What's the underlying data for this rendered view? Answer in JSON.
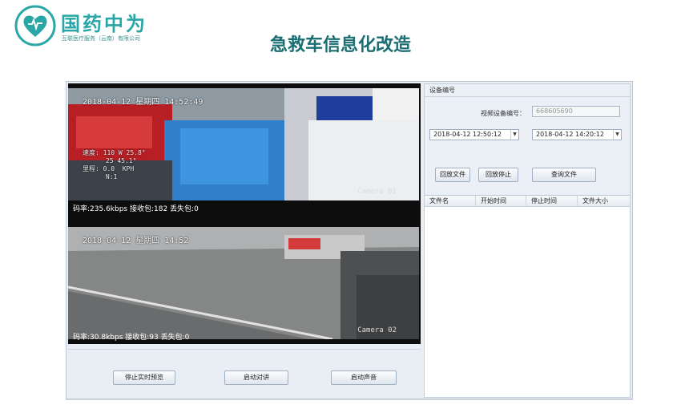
{
  "branding": {
    "company_name": "国药中为",
    "company_sub": "互联医疗服务（云南）有限公司",
    "brand_color": "#2aa6a6"
  },
  "slide": {
    "title": "急救车信息化改造",
    "title_color": "#1c6e73"
  },
  "video": {
    "camera1": {
      "timestamp": "2018-04-12 星期四 14:52:49",
      "label": "Camera 01",
      "speed_overlay": "速度: 110 W 25.8°\n      25 45.1°\n里程: 0.0  KPH\n      N:1",
      "stats": "码率:235.6kbps  接收包:182  丢失包:0"
    },
    "camera2": {
      "timestamp": "2018-04-12 星期四 14:52",
      "label": "Camera 02",
      "stats": "码率:30.8kbps  接收包:93  丢失包:0"
    }
  },
  "controls": {
    "stop_preview": "停止实时预览",
    "start_talk": "启动对讲",
    "start_sound": "启动声音"
  },
  "right_panel": {
    "header": "设备编号",
    "device_label": "视频设备编号：",
    "device_value": "668605690",
    "start_time": "2018-04-12 12:50:12",
    "end_time": "2018-04-12 14:20:12",
    "playback_btn": "回放文件",
    "playback_stop_btn": "回放停止",
    "query_btn": "查询文件",
    "table_headers": [
      "文件名",
      "开始时间",
      "停止时间",
      "文件大小"
    ]
  }
}
